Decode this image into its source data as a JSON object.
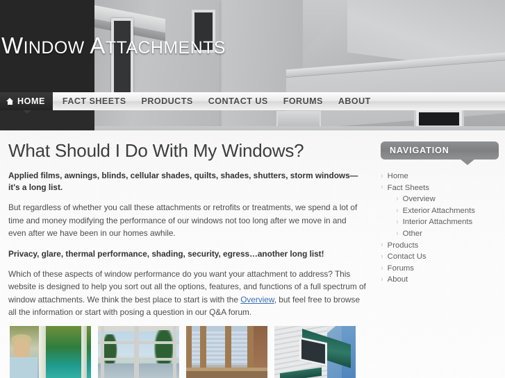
{
  "site": {
    "title_part1_cap": "W",
    "title_part1_rest": "INDOW",
    "title_part2_cap": "A",
    "title_part2_rest": "TTACHMENTS",
    "banner_image_alt": "grayscale illustration of house exterior with windows"
  },
  "nav": {
    "home_label": "HOME",
    "home_icon": "house-icon",
    "items": [
      {
        "label": "FACT SHEETS"
      },
      {
        "label": "PRODUCTS"
      },
      {
        "label": "CONTACT US"
      },
      {
        "label": "FORUMS"
      },
      {
        "label": "ABOUT"
      }
    ]
  },
  "main": {
    "heading": "What Should I Do With My Windows?",
    "lead1": "Applied films, awnings, blinds, cellular shades, quilts, shades, shutters, storm windows—it's a long list.",
    "para1": "But regardless of whether you call these attachments or retrofits or treatments, we spend a lot of time and money modifying the performance of our windows not too long after we move in and even after we have been in our homes awhile.",
    "lead2": "Privacy, glare, thermal performance, shading, security, egress…another long list!",
    "para2_before": "Which of these aspects of window performance do you want your attachment to address? This website is designed to help you sort out all the options, features, and functions of a full spectrum of window attachments. We think the best place to start is with the ",
    "para2_link": "Overview",
    "para2_after": ", but feel free to browse all the information or start with posing a question in our Q&A forum."
  },
  "thumbnails": [
    {
      "name": "woman-at-window-thumbnail"
    },
    {
      "name": "patio-door-lake-view-thumbnail"
    },
    {
      "name": "interior-cellular-shades-thumbnail"
    },
    {
      "name": "exterior-awning-thumbnail"
    }
  ],
  "sidebar": {
    "heading": "NAVIGATION",
    "items": [
      {
        "label": "Home",
        "level": 1
      },
      {
        "label": "Fact Sheets",
        "level": 1
      },
      {
        "label": "Overview",
        "level": 2
      },
      {
        "label": "Exterior Attachments",
        "level": 2
      },
      {
        "label": "Interior Attachments",
        "level": 2
      },
      {
        "label": "Other",
        "level": 2
      },
      {
        "label": "Products",
        "level": 1
      },
      {
        "label": "Contact Us",
        "level": 1
      },
      {
        "label": "Forums",
        "level": 1
      },
      {
        "label": "About",
        "level": 1
      }
    ],
    "bullet_glyph": "›"
  },
  "colors": {
    "link": "#3c6eb4",
    "dark_panel": "#262626",
    "sidebar_head": "#8c8d8f"
  }
}
